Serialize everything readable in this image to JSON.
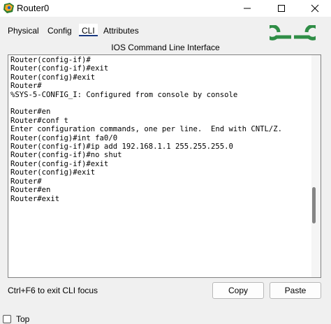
{
  "window": {
    "title": "Router0"
  },
  "tabs": [
    {
      "label": "Physical"
    },
    {
      "label": "Config"
    },
    {
      "label": "CLI"
    },
    {
      "label": "Attributes"
    }
  ],
  "panel": {
    "title": "IOS Command Line Interface"
  },
  "terminal": {
    "lines": [
      "Router(config-if)#",
      "Router(config-if)#exit",
      "Router(config)#exit",
      "Router#",
      "%SYS-5-CONFIG_I: Configured from console by console",
      "",
      "Router#en",
      "Router#conf t",
      "Enter configuration commands, one per line.  End with CNTL/Z.",
      "Router(config)#int fa0/0",
      "Router(config-if)#ip add 192.168.1.1 255.255.255.0",
      "Router(config-if)#no shut",
      "Router(config-if)#exit",
      "Router(config)#exit",
      "Router#",
      "Router#en",
      "Router#exit"
    ]
  },
  "footer": {
    "hint": "Ctrl+F6 to exit CLI focus",
    "copy_label": "Copy",
    "paste_label": "Paste",
    "top_label": "Top"
  },
  "colors": {
    "logo": "#2f8d46",
    "tab_underline": "#1a3a80"
  },
  "icons": {
    "app": "packet-tracer-router-icon",
    "logo": "geeksforgeeks-logo-icon"
  }
}
